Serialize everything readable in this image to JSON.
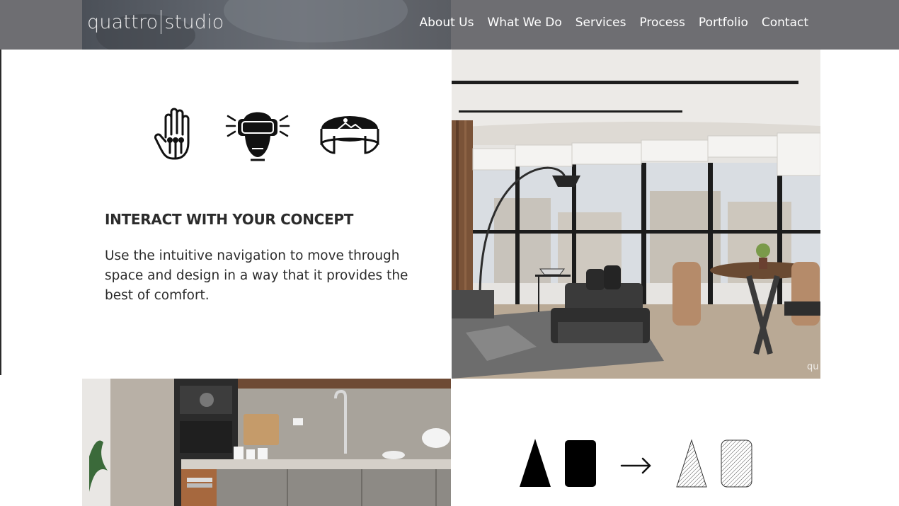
{
  "header": {
    "logo_left": "quattro",
    "logo_right": "studio",
    "nav": [
      "About Us",
      "What We Do",
      "Services",
      "Process",
      "Portfolio",
      "Contact"
    ]
  },
  "icons": [
    "hand-gesture-icon",
    "vr-headset-icon",
    "panorama-icon"
  ],
  "concept": {
    "title": "INTERACT WITH YOUR CONCEPT",
    "body": "Use the intuitive navigation to move through space and design in a way that it provides the best of comfort."
  },
  "living_image": {
    "watermark": "qu"
  },
  "colors": {
    "header_bg": "#6e6e72",
    "text": "#2b2b2b",
    "nav_text": "#ffffff"
  }
}
